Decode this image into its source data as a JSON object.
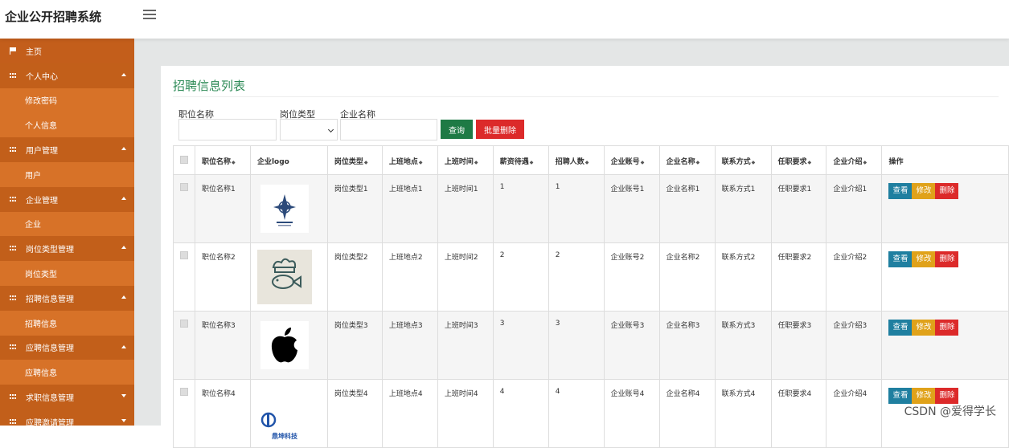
{
  "app_title": "企业公开招聘系统",
  "sidebar": {
    "items": [
      {
        "label": "主页",
        "kind": "home",
        "icon": "flag-icon"
      },
      {
        "label": "个人中心",
        "kind": "group",
        "icon": "grid-icon",
        "caret": "up"
      },
      {
        "label": "修改密码",
        "kind": "sub"
      },
      {
        "label": "个人信息",
        "kind": "sub"
      },
      {
        "label": "用户管理",
        "kind": "group",
        "icon": "grid-icon",
        "caret": "up"
      },
      {
        "label": "用户",
        "kind": "sub"
      },
      {
        "label": "企业管理",
        "kind": "group",
        "icon": "grid-icon",
        "caret": "up"
      },
      {
        "label": "企业",
        "kind": "sub"
      },
      {
        "label": "岗位类型管理",
        "kind": "group",
        "icon": "grid-icon",
        "caret": "up"
      },
      {
        "label": "岗位类型",
        "kind": "sub"
      },
      {
        "label": "招聘信息管理",
        "kind": "group",
        "icon": "grid-icon",
        "caret": "up"
      },
      {
        "label": "招聘信息",
        "kind": "sub"
      },
      {
        "label": "应聘信息管理",
        "kind": "group",
        "icon": "grid-icon",
        "caret": "up"
      },
      {
        "label": "应聘信息",
        "kind": "sub"
      },
      {
        "label": "求职信息管理",
        "kind": "group",
        "icon": "grid-icon",
        "caret": "down"
      },
      {
        "label": "应聘邀请管理",
        "kind": "group",
        "icon": "grid-icon",
        "caret": "down"
      }
    ]
  },
  "page_title": "招聘信息列表",
  "search": {
    "label_job": "职位名称",
    "label_type": "岗位类型",
    "label_company": "企业名称",
    "job_value": "",
    "company_value": "",
    "query_label": "查询",
    "batch_delete_label": "批量删除"
  },
  "table": {
    "headers": [
      "职位名称",
      "企业logo",
      "岗位类型",
      "上班地点",
      "上班时间",
      "薪资待遇",
      "招聘人数",
      "企业账号",
      "企业名称",
      "联系方式",
      "任职要求",
      "企业介绍",
      "操作"
    ],
    "sortable": [
      true,
      false,
      true,
      true,
      true,
      true,
      true,
      true,
      true,
      true,
      true,
      true,
      false
    ],
    "rows": [
      {
        "job": "职位名称1",
        "logo": "compass-logo",
        "type": "岗位类型1",
        "place": "上班地点1",
        "time": "上班时间1",
        "salary": "1",
        "count": "1",
        "account": "企业账号1",
        "company": "企业名称1",
        "contact": "联系方式1",
        "req": "任职要求1",
        "intro": "企业介绍1"
      },
      {
        "job": "职位名称2",
        "logo": "chef-fish-logo",
        "type": "岗位类型2",
        "place": "上班地点2",
        "time": "上班时间2",
        "salary": "2",
        "count": "2",
        "account": "企业账号2",
        "company": "企业名称2",
        "contact": "联系方式2",
        "req": "任职要求2",
        "intro": "企业介绍2"
      },
      {
        "job": "职位名称3",
        "logo": "apple-logo",
        "type": "岗位类型3",
        "place": "上班地点3",
        "time": "上班时间3",
        "salary": "3",
        "count": "3",
        "account": "企业账号3",
        "company": "企业名称3",
        "contact": "联系方式3",
        "req": "任职要求3",
        "intro": "企业介绍3"
      },
      {
        "job": "职位名称4",
        "logo": "tech-company-logo",
        "type": "岗位类型4",
        "place": "上班地点4",
        "time": "上班时间4",
        "salary": "4",
        "count": "4",
        "account": "企业账号4",
        "company": "企业名称4",
        "contact": "联系方式4",
        "req": "任职要求4",
        "intro": "企业介绍4"
      }
    ],
    "actions": {
      "view": "查看",
      "edit": "修改",
      "delete": "删除"
    }
  },
  "logo_text": {
    "company4": "鼎坤科技"
  },
  "watermark": "CSDN @爱得学长",
  "colors": {
    "sidebar": "#d2691e",
    "title_green": "#2e8b57",
    "query_btn": "#1e7a45",
    "delete_btn": "#dc2a2a",
    "view_btn": "#1f7fa0",
    "edit_btn": "#e0a21a"
  }
}
